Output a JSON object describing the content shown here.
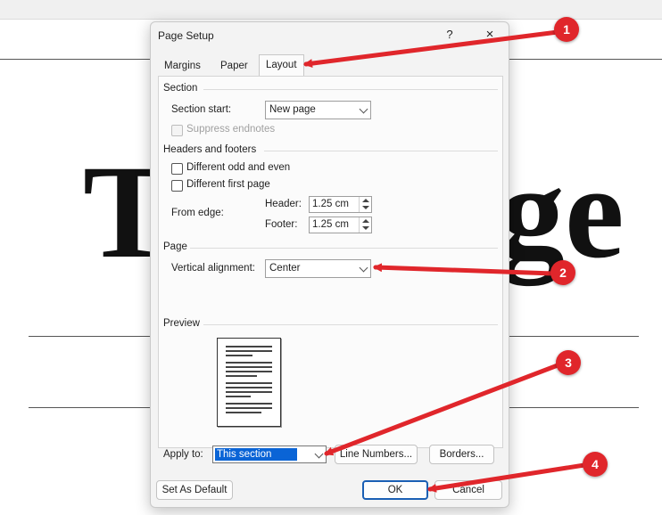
{
  "background": {
    "big_text_left": "T",
    "big_text_right": "ge"
  },
  "dialog": {
    "title": "Page Setup",
    "help": "?",
    "close": "×",
    "tabs": [
      {
        "label": "Margins"
      },
      {
        "label": "Paper"
      },
      {
        "label": "Layout"
      }
    ],
    "active_tab": "Layout",
    "section": {
      "header": "Section",
      "section_start_label": "Section start:",
      "section_start_value": "New page",
      "suppress_endnotes_label": "Suppress endnotes",
      "suppress_endnotes_checked": false
    },
    "headers_footers": {
      "header": "Headers and footers",
      "different_odd_even_label": "Different odd and even",
      "different_odd_even_checked": false,
      "different_first_page_label": "Different first page",
      "different_first_page_checked": false,
      "from_edge_label": "From edge:",
      "header_label": "Header:",
      "header_value": "1.25 cm",
      "footer_label": "Footer:",
      "footer_value": "1.25 cm"
    },
    "page": {
      "header": "Page",
      "vertical_alignment_label": "Vertical alignment:",
      "vertical_alignment_value": "Center"
    },
    "preview": {
      "header": "Preview"
    },
    "apply_to_label": "Apply to:",
    "apply_to_value": "This section",
    "line_numbers_button": "Line Numbers...",
    "borders_button": "Borders...",
    "set_as_default_button": "Set As Default",
    "ok_button": "OK",
    "cancel_button": "Cancel"
  },
  "annotations": {
    "color": "#e0262b",
    "badges": [
      "1",
      "2",
      "3",
      "4"
    ]
  }
}
